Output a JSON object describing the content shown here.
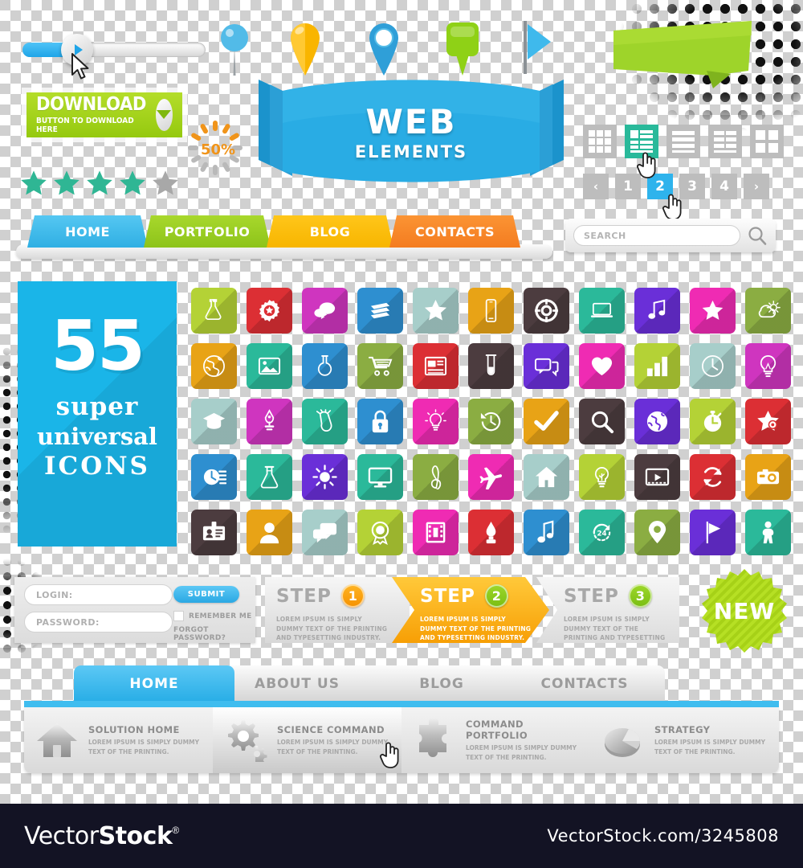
{
  "slider": {
    "value_percent": 27,
    "play_icon": "play-triangle-icon"
  },
  "download": {
    "title": "DOWNLOAD",
    "subtitle": "BUTTON TO DOWNLOAD HERE",
    "icon": "chevron-down-icon",
    "color": "#a6d219"
  },
  "loader": {
    "percent_label": "50%",
    "accent": "#f0941a",
    "idle": "#b9b9b9"
  },
  "rating": {
    "filled": 4,
    "total": 5,
    "filled_color": "#2fb694",
    "empty_color": "#a8a8a8"
  },
  "pins": [
    {
      "name": "round-blue-pushpin",
      "color": "#4db8e8"
    },
    {
      "name": "yellow-teardrop-marker",
      "color": "#f9b800"
    },
    {
      "name": "blue-ring-marker",
      "color": "#2f9fd8"
    },
    {
      "name": "green-square-marker",
      "color": "#8fd116"
    },
    {
      "name": "blue-flag-marker",
      "color": "#3fb9ec"
    }
  ],
  "ribbon": {
    "line1": "WEB",
    "line2": "ELEMENTS",
    "color": "#29ace4"
  },
  "origami": {
    "color": "#9ed42a"
  },
  "view_toggle": {
    "options": [
      {
        "name": "grid-view-icon",
        "active": false
      },
      {
        "name": "list-detail-view-icon",
        "active": true
      },
      {
        "name": "rows-view-icon",
        "active": false
      },
      {
        "name": "two-column-view-icon",
        "active": false
      },
      {
        "name": "large-grid-view-icon",
        "active": false
      }
    ],
    "active_color": "#29b99a",
    "idle_color": "#bdbdbd"
  },
  "pagination": {
    "prev_label": "‹",
    "next_label": "›",
    "pages": [
      "1",
      "2",
      "3",
      "4"
    ],
    "active_page": "2",
    "active_color": "#2eb3ec"
  },
  "top_nav": {
    "items": [
      {
        "label": "HOME",
        "color": "#3fb9ec"
      },
      {
        "label": "PORTFOLIO",
        "color": "#9ccd1e"
      },
      {
        "label": "BLOG",
        "color": "#fbbc05"
      },
      {
        "label": "CONTACTS",
        "color": "#f78524"
      }
    ]
  },
  "search": {
    "placeholder": "SEARCH",
    "value": "",
    "icon": "magnifier-icon"
  },
  "promo": {
    "count": "55",
    "word1": "super",
    "word2": "universal",
    "word3": "ICONS",
    "background": "#1ab5e8"
  },
  "icon_grid": {
    "columns": 11,
    "rows": 5,
    "tiles": [
      {
        "name": "flask-icon",
        "color": "#b4d236"
      },
      {
        "name": "gear-star-icon",
        "color": "#dc2f34"
      },
      {
        "name": "chat-bubbles-icon",
        "color": "#cf35bf"
      },
      {
        "name": "layers-icon",
        "color": "#2e8fd0"
      },
      {
        "name": "star-icon",
        "color": "#a7ceca"
      },
      {
        "name": "smartphone-icon",
        "color": "#e8a316"
      },
      {
        "name": "lifebuoy-icon",
        "color": "#4c3c3f"
      },
      {
        "name": "laptop-icon",
        "color": "#2bb99a"
      },
      {
        "name": "music-note-icon",
        "color": "#6a2fd8"
      },
      {
        "name": "star-filled-icon",
        "color": "#ef2bb3"
      },
      {
        "name": "weather-cloud-sun-icon",
        "color": "#8bad42"
      },
      {
        "name": "globe-outline-icon",
        "color": "#e8a316"
      },
      {
        "name": "image-photo-icon",
        "color": "#2bb99a"
      },
      {
        "name": "round-flask-icon",
        "color": "#2e8fd0"
      },
      {
        "name": "shopping-cart-icon",
        "color": "#8bad42"
      },
      {
        "name": "news-article-icon",
        "color": "#dc2f34"
      },
      {
        "name": "test-tube-icon",
        "color": "#4c3c3f"
      },
      {
        "name": "chat-reply-icon",
        "color": "#6a2fd8"
      },
      {
        "name": "heart-icon",
        "color": "#ef2bb3"
      },
      {
        "name": "bar-chart-icon",
        "color": "#b4d236"
      },
      {
        "name": "clock-icon",
        "color": "#a7ceca"
      },
      {
        "name": "lightbulb-outline-icon",
        "color": "#cf35bf"
      },
      {
        "name": "graduation-cap-icon",
        "color": "#a7ceca"
      },
      {
        "name": "fountain-pen-icon",
        "color": "#cf35bf"
      },
      {
        "name": "diploma-scroll-icon",
        "color": "#2bb99a"
      },
      {
        "name": "padlock-icon",
        "color": "#2e8fd0"
      },
      {
        "name": "lightbulb-idea-icon",
        "color": "#ef2bb3"
      },
      {
        "name": "history-clock-icon",
        "color": "#8bad42"
      },
      {
        "name": "checkmark-icon",
        "color": "#e8a316"
      },
      {
        "name": "magnifier-search-icon",
        "color": "#4c3c3f"
      },
      {
        "name": "globe-world-icon",
        "color": "#6a2fd8"
      },
      {
        "name": "stopwatch-icon",
        "color": "#b4d236"
      },
      {
        "name": "star-location-icon",
        "color": "#dc2f34"
      },
      {
        "name": "fast-clock-icon",
        "color": "#2e8fd0"
      },
      {
        "name": "conical-flask-icon",
        "color": "#2bb99a"
      },
      {
        "name": "sun-brightness-icon",
        "color": "#6a2fd8"
      },
      {
        "name": "monitor-screen-icon",
        "color": "#2bb99a"
      },
      {
        "name": "treble-clef-icon",
        "color": "#8bad42"
      },
      {
        "name": "airplane-icon",
        "color": "#ef2bb3"
      },
      {
        "name": "home-house-icon",
        "color": "#a7ceca"
      },
      {
        "name": "lightbulb-eco-icon",
        "color": "#b4d236"
      },
      {
        "name": "video-player-icon",
        "color": "#4c3c3f"
      },
      {
        "name": "refresh-sync-icon",
        "color": "#dc2f34"
      },
      {
        "name": "camera-icon",
        "color": "#e8a316"
      },
      {
        "name": "id-badge-icon",
        "color": "#4c3c3f"
      },
      {
        "name": "user-person-icon",
        "color": "#e8a316"
      },
      {
        "name": "speech-bubbles-icon",
        "color": "#a7ceca"
      },
      {
        "name": "award-ribbon-icon",
        "color": "#b4d236"
      },
      {
        "name": "film-strip-icon",
        "color": "#ef2bb3"
      },
      {
        "name": "paint-brush-icon",
        "color": "#dc2f34"
      },
      {
        "name": "music-note-single-icon",
        "color": "#2e8fd0"
      },
      {
        "name": "24-hours-icon",
        "color": "#2bb99a"
      },
      {
        "name": "map-pin-icon",
        "color": "#8bad42"
      },
      {
        "name": "flag-icon",
        "color": "#6a2fd8"
      },
      {
        "name": "person-fitness-icon",
        "color": "#2bb99a"
      }
    ]
  },
  "login": {
    "login_placeholder": "LOGIN:",
    "login_value": "",
    "password_placeholder": "PASSWORD:",
    "password_value": "",
    "submit_label": "SUBMIT",
    "remember_label": "REMEMBER ME",
    "forgot_label": "FORGOT  PASSWORD?",
    "remember_checked": false
  },
  "steps": [
    {
      "word": "STEP",
      "number": "1",
      "body": "LOREM IPSUM IS SIMPLY DUMMY TEXT OF THE PRINTING AND TYPESETTING INDUSTRY.",
      "active": false,
      "number_color": "#f59100"
    },
    {
      "word": "STEP",
      "number": "2",
      "body": "LOREM IPSUM IS SIMPLY DUMMY TEXT OF THE PRINTING AND TYPESETTING INDUSTRY.",
      "active": true,
      "number_color": "#79bd12"
    },
    {
      "word": "STEP",
      "number": "3",
      "body": "LOREM IPSUM IS SIMPLY DUMMY TEXT OF THE PRINTING AND TYPESETTING INDUSTRY.",
      "active": false,
      "number_color": "#79bd12"
    }
  ],
  "new_badge": {
    "label": "NEW",
    "color": "#a9d91c"
  },
  "bottom_nav": {
    "tabs": [
      {
        "label": "HOME",
        "active": true
      },
      {
        "label": "ABOUT US",
        "active": false
      },
      {
        "label": "BLOG",
        "active": false
      },
      {
        "label": "CONTACTS",
        "active": false
      }
    ],
    "accent": "#3fbdef",
    "items": [
      {
        "icon": "house-3d-icon",
        "title": "SOLUTION HOME",
        "desc": "LOREM IPSUM IS SIMPLY DUMMY TEXT OF THE PRINTING.",
        "highlighted": false
      },
      {
        "icon": "gears-3d-icon",
        "title": "SCIENCE COMMAND",
        "desc": "LOREM IPSUM IS SIMPLY DUMMY TEXT OF THE PRINTING.",
        "highlighted": true
      },
      {
        "icon": "puzzle-piece-3d-icon",
        "title": "COMMAND PORTFOLIO",
        "desc": "LOREM IPSUM IS SIMPLY DUMMY TEXT OF THE PRINTING.",
        "highlighted": false
      },
      {
        "icon": "pie-chart-3d-icon",
        "title": "STRATEGY",
        "desc": "LOREM IPSUM IS SIMPLY DUMMY TEXT OF THE PRINTING.",
        "highlighted": false
      }
    ]
  },
  "footer": {
    "brand_light": "Vector",
    "brand_bold": "Stock",
    "registered": "®",
    "url": "VectorStock.com/3245808",
    "background": "#131324"
  }
}
